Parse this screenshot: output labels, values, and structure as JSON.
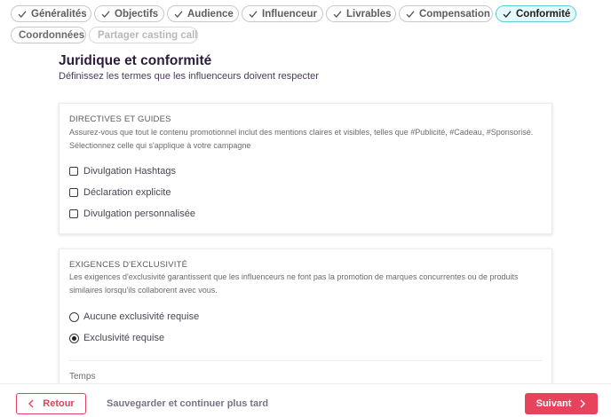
{
  "tabs": [
    {
      "label": "Généralités",
      "checked": true
    },
    {
      "label": "Objectifs",
      "checked": true
    },
    {
      "label": "Audience",
      "checked": true
    },
    {
      "label": "Influenceur",
      "checked": true
    },
    {
      "label": "Livrables",
      "checked": true
    },
    {
      "label": "Compensation",
      "checked": true
    },
    {
      "label": "Conformité",
      "checked": true,
      "active": true
    },
    {
      "label": "Coordonnées",
      "checked": false
    },
    {
      "label": "Partager casting call",
      "checked": false,
      "disabled": true
    }
  ],
  "header": {
    "title": "Juridique et conformité",
    "subtitle": "Définissez les termes que les influenceurs doivent respecter"
  },
  "guidelines": {
    "title": "DIRECTIVES ET GUIDES",
    "description": "Assurez-vous que tout le contenu promotionnel inclut des mentions claires et visibles, telles que #Publicité, #Cadeau, #Sponsorisé. Sélectionnez celle qui s'applique à votre campagne",
    "options": [
      {
        "label": "Divulgation Hashtags",
        "checked": false
      },
      {
        "label": "Déclaration explicite",
        "checked": false
      },
      {
        "label": "Divulgation personnalisée",
        "checked": false
      }
    ]
  },
  "exclusivity": {
    "title": "EXIGENCES D'EXCLUSIVITÉ",
    "description": "Les exigences d'exclusivité garantissent que les influenceurs ne font pas la promotion de marques concurrentes ou de produits similaires lorsqu'ils collaborent avec vous.",
    "options": [
      {
        "label": "Aucune exclusivité requise",
        "selected": false
      },
      {
        "label": "Exclusivité requise",
        "selected": true
      }
    ],
    "time_label": "Temps"
  },
  "footer": {
    "back_label": "Retour",
    "save_later_label": "Sauvegarder et continuer plus tard",
    "next_label": "Suivant"
  },
  "colors": {
    "accent": "#e8435d",
    "active_tab_bg": "#e5f8fb",
    "active_tab_border": "#5fcfdc",
    "title": "#2d1b3d"
  },
  "icons": {
    "tab_check": "check-icon",
    "back": "chevron-left-icon",
    "next": "chevron-right-icon"
  }
}
